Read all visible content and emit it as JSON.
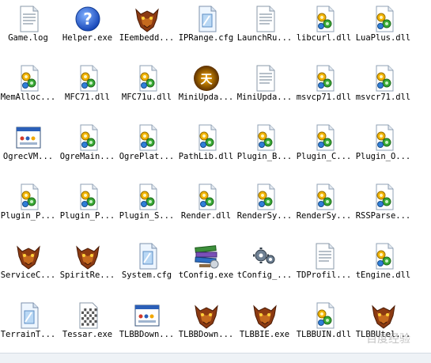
{
  "files": [
    {
      "label": "Game.log",
      "icon": "text-file-icon"
    },
    {
      "label": "Helper.exe",
      "icon": "help-icon"
    },
    {
      "label": "IEembedd...",
      "icon": "dragon-head-icon"
    },
    {
      "label": "IPRange.cfg",
      "icon": "config-file-icon"
    },
    {
      "label": "LaunchRu...",
      "icon": "text-file-icon"
    },
    {
      "label": "libcurl.dll",
      "icon": "dll-file-icon"
    },
    {
      "label": "LuaPlus.dll",
      "icon": "dll-file-icon"
    },
    {
      "label": "MemAlloc...",
      "icon": "dll-file-icon"
    },
    {
      "label": "MFC71.dll",
      "icon": "dll-file-icon"
    },
    {
      "label": "MFC71u.dll",
      "icon": "dll-file-icon"
    },
    {
      "label": "MiniUpda...",
      "icon": "game-logo-icon"
    },
    {
      "label": "MiniUpda...",
      "icon": "text-file-icon"
    },
    {
      "label": "msvcp71.dll",
      "icon": "dll-file-icon"
    },
    {
      "label": "msvcr71.dll",
      "icon": "dll-file-icon"
    },
    {
      "label": "OgrecVM...",
      "icon": "application-window-icon"
    },
    {
      "label": "OgreMain...",
      "icon": "dll-file-icon"
    },
    {
      "label": "OgrePlat...",
      "icon": "dll-file-icon"
    },
    {
      "label": "PathLib.dll",
      "icon": "dll-file-icon"
    },
    {
      "label": "Plugin_B...",
      "icon": "dll-file-icon"
    },
    {
      "label": "Plugin_C...",
      "icon": "dll-file-icon"
    },
    {
      "label": "Plugin_O...",
      "icon": "dll-file-icon"
    },
    {
      "label": "Plugin_P...",
      "icon": "dll-file-icon"
    },
    {
      "label": "Plugin_P...",
      "icon": "dll-file-icon"
    },
    {
      "label": "Plugin_S...",
      "icon": "dll-file-icon"
    },
    {
      "label": "Render.dll",
      "icon": "dll-file-icon"
    },
    {
      "label": "RenderSy...",
      "icon": "dll-file-icon"
    },
    {
      "label": "RenderSy...",
      "icon": "dll-file-icon"
    },
    {
      "label": "RSSParse...",
      "icon": "dll-file-icon"
    },
    {
      "label": "ServiceC...",
      "icon": "dragon-head-icon"
    },
    {
      "label": "SpiritRe...",
      "icon": "dragon-head-icon"
    },
    {
      "label": "System.cfg",
      "icon": "config-file-icon"
    },
    {
      "label": "tConfig.exe",
      "icon": "books-installer-icon"
    },
    {
      "label": "tConfig_...",
      "icon": "gears-icon"
    },
    {
      "label": "TDProfil...",
      "icon": "text-file-icon"
    },
    {
      "label": "tEngine.dll",
      "icon": "dll-file-icon"
    },
    {
      "label": "TerrainT...",
      "icon": "config-file-icon"
    },
    {
      "label": "Tessar.exe",
      "icon": "tessar-grid-icon"
    },
    {
      "label": "TLBBDown...",
      "icon": "application-window-icon"
    },
    {
      "label": "TLBBDown...",
      "icon": "dragon-head-icon"
    },
    {
      "label": "TLBBIE.exe",
      "icon": "dragon-head-icon"
    },
    {
      "label": "TLBBUIN.dll",
      "icon": "dll-file-icon"
    },
    {
      "label": "TLBBUtel...",
      "icon": "dragon-head-icon"
    }
  ],
  "watermark": "百度经验"
}
